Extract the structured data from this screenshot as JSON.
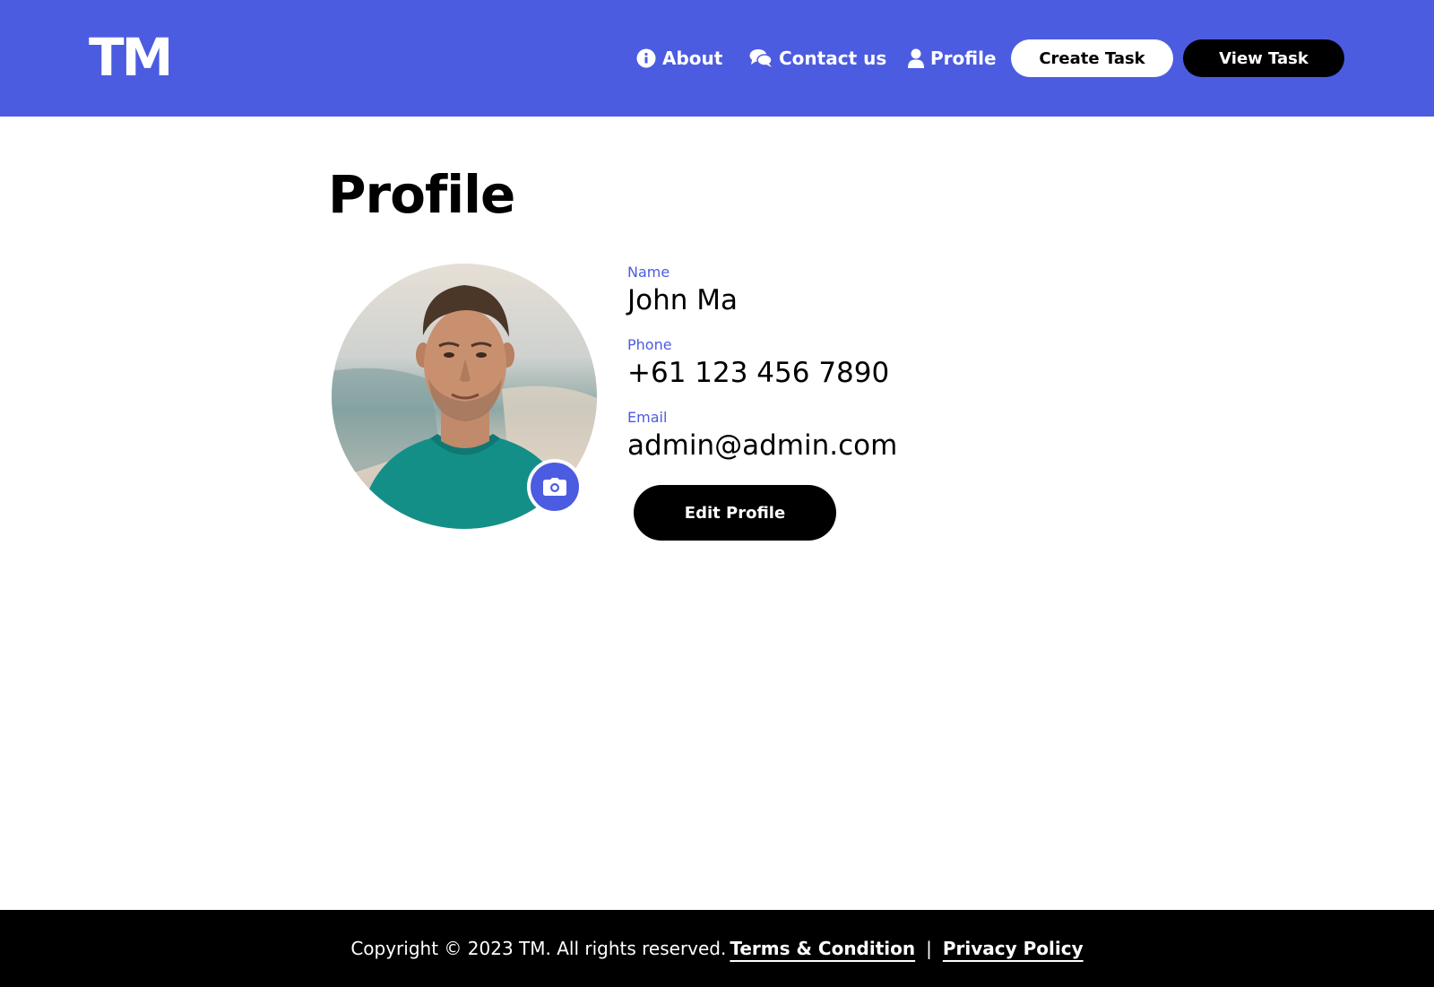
{
  "header": {
    "logo": "TM",
    "nav": [
      {
        "label": "About",
        "icon": "info-icon"
      },
      {
        "label": "Contact us",
        "icon": "chat-icon"
      },
      {
        "label": "Profile",
        "icon": "user-icon"
      }
    ],
    "create_task_label": "Create Task",
    "view_task_label": "View Task"
  },
  "main": {
    "title": "Profile",
    "avatar_alt": "Profile photo",
    "fields": [
      {
        "label": "Name",
        "value": "John Ma"
      },
      {
        "label": "Phone",
        "value": "+61 123 456 7890"
      },
      {
        "label": "Email",
        "value": "admin@admin.com"
      }
    ],
    "edit_label": "Edit Profile"
  },
  "footer": {
    "copyright": "Copyright ©  2023 TM. All rights reserved.",
    "terms_label": "Terms & Condition",
    "separator": "|",
    "privacy_label": "Privacy Policy"
  },
  "colors": {
    "accent": "#4c5ce0",
    "header_bg": "#4c5ce0",
    "footer_bg": "#000000"
  }
}
